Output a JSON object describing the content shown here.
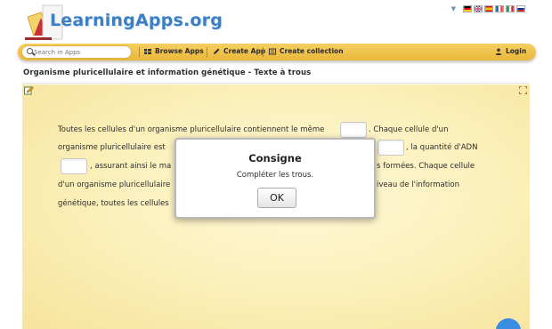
{
  "brand": {
    "name": "LearningApps.org"
  },
  "languages": {
    "menu_arrow_icon": "triangle-down-icon",
    "flags": [
      {
        "name": "german-flag-icon",
        "colors": [
          "#000000",
          "#dd0000",
          "#ffce00"
        ]
      },
      {
        "name": "english-flag-icon",
        "colors": [
          "#012169",
          "#ffffff",
          "#c8102e"
        ]
      },
      {
        "name": "spanish-flag-icon",
        "colors": [
          "#c60b1e",
          "#ffc400",
          "#c60b1e"
        ]
      },
      {
        "name": "french-flag-icon",
        "colors": [
          "#0055a4",
          "#ffffff",
          "#ef4135"
        ]
      },
      {
        "name": "italian-flag-icon",
        "colors": [
          "#009246",
          "#ffffff",
          "#ce2b37"
        ]
      },
      {
        "name": "russian-flag-icon",
        "colors": [
          "#ffffff",
          "#0039a6",
          "#d52b1e"
        ]
      }
    ]
  },
  "navbar": {
    "search_placeholder": "Search in Apps",
    "browse": "Browse Apps",
    "create_app": "Create App",
    "create_collection": "Create collection",
    "login": "Login"
  },
  "page": {
    "title": "Organisme pluricellulaire et information génétique - Texte à trous"
  },
  "exercise": {
    "line1_a": "Toutes les cellules d'un organisme pluricellulaire contiennent le même",
    "line1_b": ". Chaque cellule d'un",
    "line2_a": "organisme pluricellulaire est",
    "line2_b": ", la quantité d'ADN",
    "line3_a": ", assurant ainsi le ma",
    "line3_b": "s formées. Chaque cellule",
    "line4_a": "d'un organisme pluricellulaire",
    "line4_b": "iveau de l'information",
    "line5_a": "génétique, toutes les cellules"
  },
  "modal": {
    "title": "Consigne",
    "text": "Compléter les trous.",
    "button": "OK"
  },
  "colors": {
    "brand_blue": "#3d7fc4",
    "nav_yellow": "#f0c24b",
    "app_bg": "#fbefb8",
    "help_blue": "#3a8de0"
  }
}
